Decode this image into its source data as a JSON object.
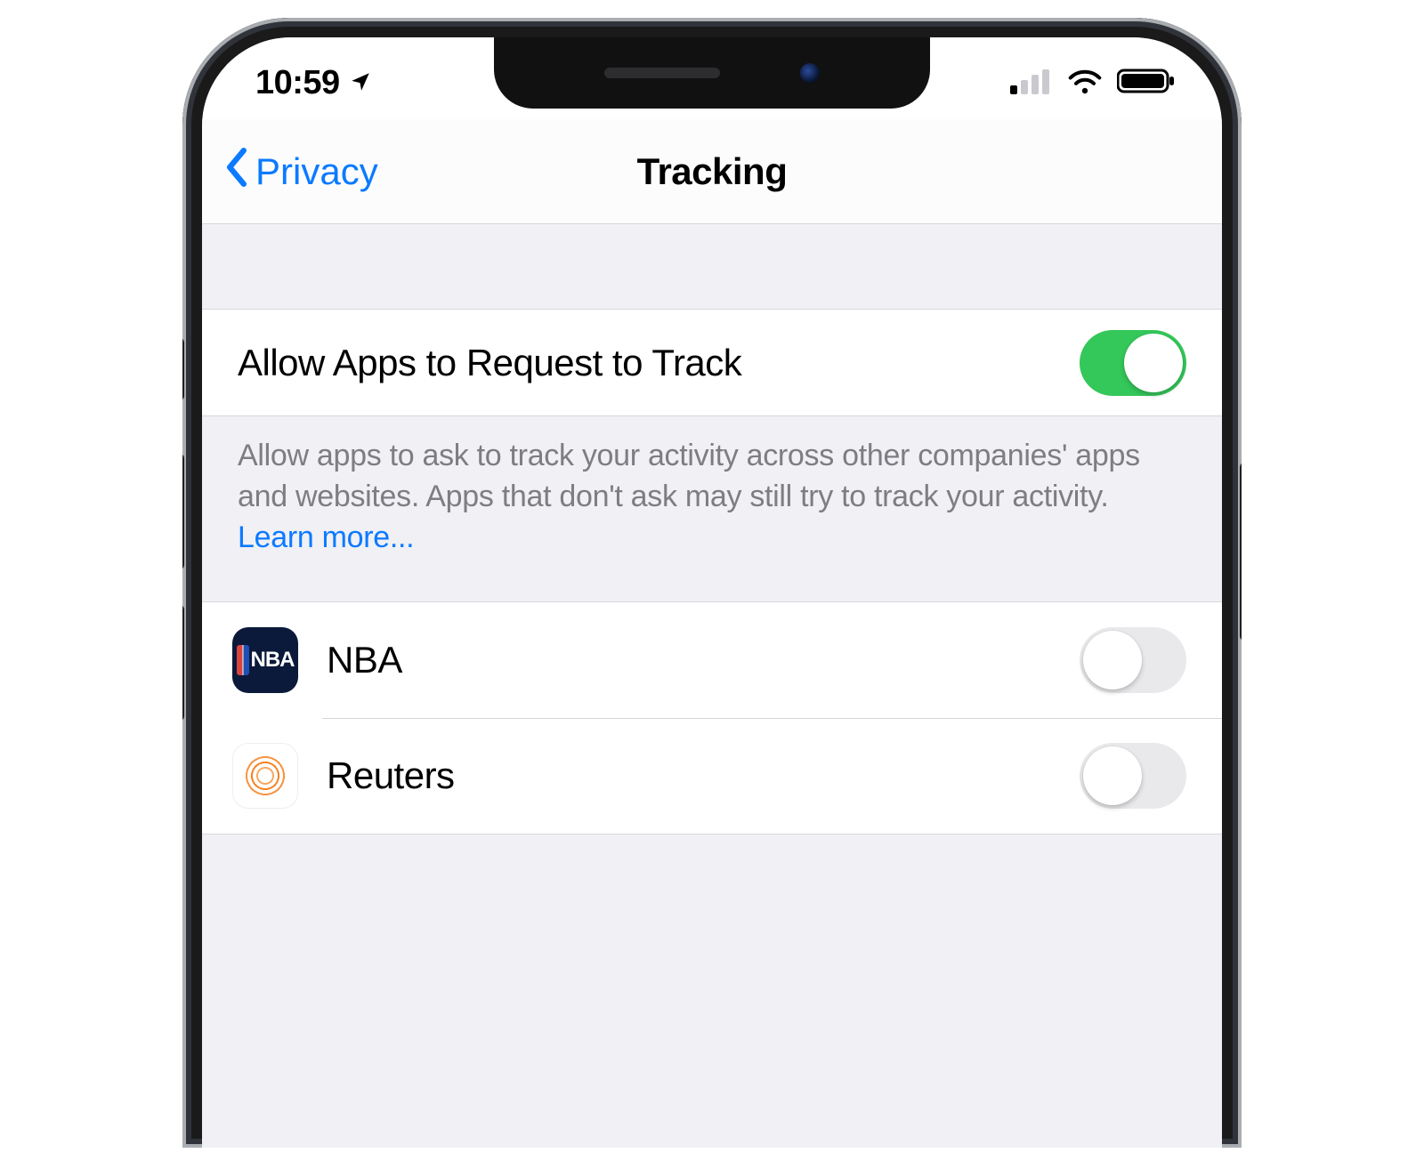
{
  "status": {
    "time": "10:59",
    "location_icon": "location-arrow",
    "cellular_bars": 1,
    "cellular_total": 4,
    "wifi": true,
    "battery": "full"
  },
  "nav": {
    "back_label": "Privacy",
    "title": "Tracking"
  },
  "main_toggle": {
    "label": "Allow Apps to Request to Track",
    "on": true
  },
  "footer": {
    "text": "Allow apps to ask to track your activity across other companies' apps and websites. Apps that don't ask may still try to track your activity. ",
    "link": "Learn more..."
  },
  "apps": [
    {
      "name": "NBA",
      "icon": "nba",
      "on": false
    },
    {
      "name": "Reuters",
      "icon": "reuters",
      "on": false
    }
  ],
  "colors": {
    "accent": "#0b7aff",
    "toggle_on": "#34c759",
    "bg": "#f0f0f5"
  }
}
